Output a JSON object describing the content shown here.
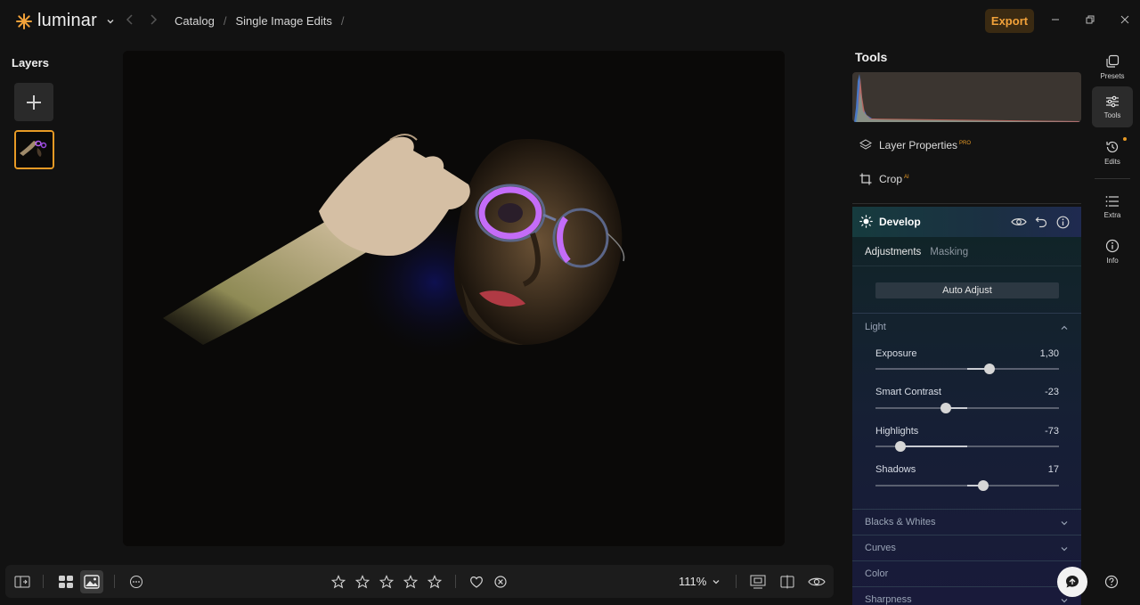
{
  "app": {
    "name": "luminar"
  },
  "breadcrumb": {
    "items": [
      "Catalog",
      "Single Image Edits"
    ],
    "separator": "/"
  },
  "header": {
    "export_label": "Export"
  },
  "layers": {
    "title": "Layers"
  },
  "tools": {
    "title": "Tools",
    "layer_properties": {
      "label": "Layer Properties",
      "badge": "PRO"
    },
    "crop": {
      "label": "Crop",
      "badge": "AI"
    }
  },
  "develop": {
    "title": "Develop",
    "tabs": [
      "Adjustments",
      "Masking"
    ],
    "auto_adjust_label": "Auto Adjust",
    "light_section": "Light",
    "adjustments": [
      {
        "label": "Exposure",
        "value": "1,30",
        "position": 0.62
      },
      {
        "label": "Smart Contrast",
        "value": "-23",
        "position": 0.385
      },
      {
        "label": "Highlights",
        "value": "-73",
        "position": 0.135
      },
      {
        "label": "Shadows",
        "value": "17",
        "position": 0.585
      }
    ],
    "collapsed_sections": [
      "Blacks & Whites",
      "Curves",
      "Color",
      "Sharpness"
    ]
  },
  "rail": {
    "items": [
      "Presets",
      "Tools",
      "Edits",
      "Extra",
      "Info"
    ],
    "active": "Tools"
  },
  "bottom": {
    "zoom_label": "111%",
    "rating_stars": 5
  },
  "colors": {
    "accent": "#e79a25",
    "background": "#121212"
  }
}
